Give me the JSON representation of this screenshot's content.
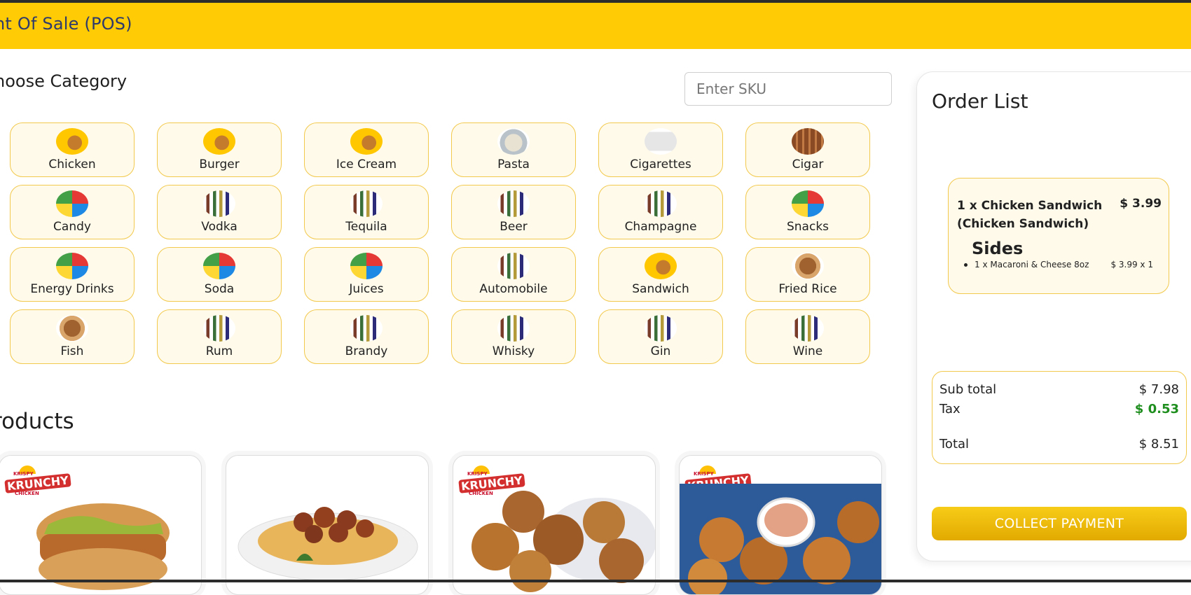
{
  "header": {
    "title": "nt Of Sale (POS)"
  },
  "categories": {
    "title": "hoose Category",
    "sku_placeholder": "Enter SKU",
    "items": [
      {
        "label": "Chicken",
        "icon": "chicken-icon"
      },
      {
        "label": "Burger",
        "icon": "burger-icon"
      },
      {
        "label": "Ice Cream",
        "icon": "ice-cream-icon"
      },
      {
        "label": "Pasta",
        "icon": "pasta-icon"
      },
      {
        "label": "Cigarettes",
        "icon": "cigarettes-icon"
      },
      {
        "label": "Cigar",
        "icon": "cigar-icon"
      },
      {
        "label": "Candy",
        "icon": "candy-icon"
      },
      {
        "label": "Vodka",
        "icon": "vodka-icon"
      },
      {
        "label": "Tequila",
        "icon": "tequila-icon"
      },
      {
        "label": "Beer",
        "icon": "beer-icon"
      },
      {
        "label": "Champagne",
        "icon": "champagne-icon"
      },
      {
        "label": "Snacks",
        "icon": "snacks-icon"
      },
      {
        "label": "Energy Drinks",
        "icon": "energy-drinks-icon"
      },
      {
        "label": "Soda",
        "icon": "soda-icon"
      },
      {
        "label": "Juices",
        "icon": "juices-icon"
      },
      {
        "label": "Automobile",
        "icon": "automobile-icon"
      },
      {
        "label": "Sandwich",
        "icon": "sandwich-icon"
      },
      {
        "label": "Fried Rice",
        "icon": "fried-rice-icon"
      },
      {
        "label": "Fish",
        "icon": "fish-icon"
      },
      {
        "label": "Rum",
        "icon": "rum-icon"
      },
      {
        "label": "Brandy",
        "icon": "brandy-icon"
      },
      {
        "label": "Whisky",
        "icon": "whisky-icon"
      },
      {
        "label": "Gin",
        "icon": "gin-icon"
      },
      {
        "label": "Wine",
        "icon": "wine-icon"
      }
    ]
  },
  "products": {
    "title": "roducts",
    "logo": {
      "top": "KRISPY",
      "mid": "KRUNCHY",
      "bottom": "CHICKEN"
    },
    "items": [
      {
        "image": "chicken-sandwich-image",
        "has_logo": true
      },
      {
        "image": "spaghetti-meatballs-image",
        "has_logo": false
      },
      {
        "image": "fried-chicken-basket-image",
        "has_logo": true
      },
      {
        "image": "chicken-tenders-dip-image",
        "has_logo": true
      }
    ]
  },
  "order": {
    "title": "Order List",
    "items": [
      {
        "name": "1 x Chicken Sandwich (Chicken Sandwich)",
        "price": "$ 3.99",
        "sides_title": "Sides",
        "sides": [
          {
            "name": "1 x Macaroni & Cheese 8oz",
            "price": "$ 3.99 x 1"
          }
        ]
      }
    ],
    "totals": {
      "subtotal_label": "Sub total",
      "subtotal": "$ 7.98",
      "tax_label": "Tax",
      "tax": "$ 0.53",
      "total_label": "Total",
      "total": "$ 8.51"
    },
    "collect_label": "COLLECT PAYMENT"
  },
  "colors": {
    "brand_yellow": "#ffcb05",
    "card_border": "#f2c94c",
    "card_bg": "#fffaea",
    "tax_green": "#1e8e1e"
  }
}
